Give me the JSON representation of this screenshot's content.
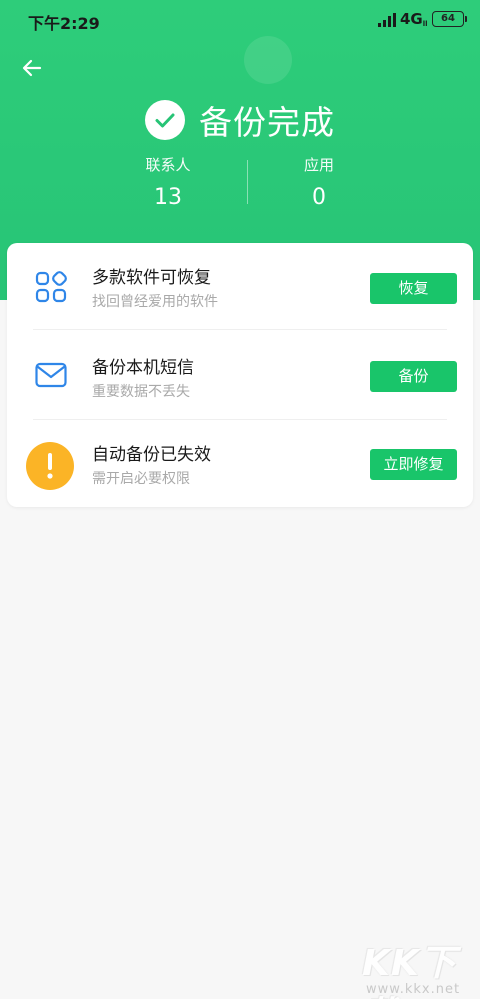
{
  "status_bar": {
    "time": "下午2:29",
    "network": "4G",
    "network_sub": "ll",
    "battery": "64"
  },
  "header": {
    "title": "备份完成",
    "stats": [
      {
        "label": "联系人",
        "value": "13"
      },
      {
        "label": "应用",
        "value": "0"
      }
    ]
  },
  "card": {
    "rows": [
      {
        "title": "多款软件可恢复",
        "subtitle": "找回曾经爱用的软件",
        "button": "恢复",
        "icon": "apps-grid-icon"
      },
      {
        "title": "备份本机短信",
        "subtitle": "重要数据不丢失",
        "button": "备份",
        "icon": "mail-icon"
      },
      {
        "title": "自动备份已失效",
        "subtitle": "需开启必要权限",
        "button": "立即修复",
        "icon": "warning-icon"
      }
    ]
  },
  "watermark": {
    "big": "KK下载",
    "small": "www.kkx.net"
  },
  "colors": {
    "header_green": "#2ecd7a",
    "button_green": "#19c56a",
    "icon_blue": "#2f86e8",
    "warning_orange": "#fbb426"
  }
}
